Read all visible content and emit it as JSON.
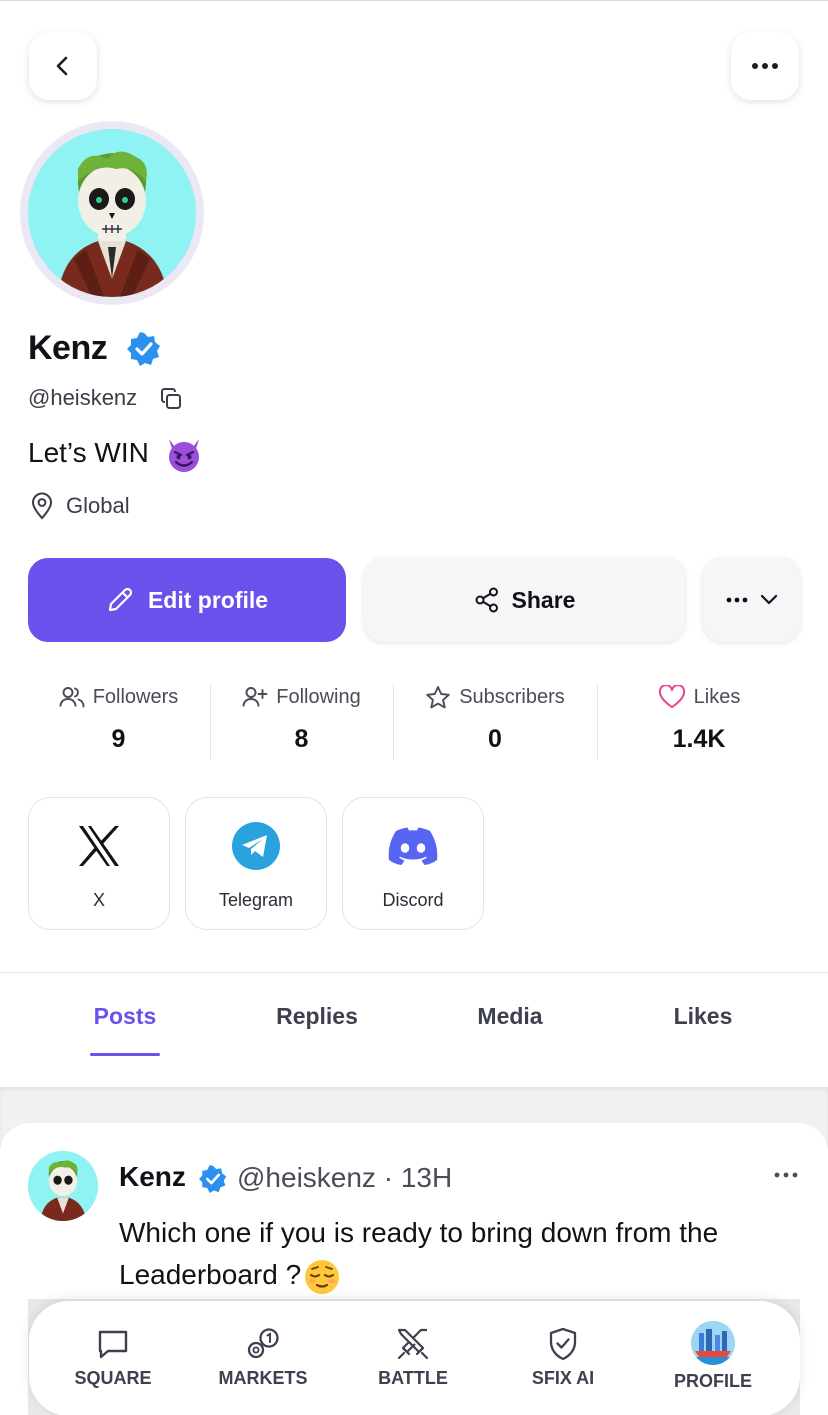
{
  "profile": {
    "name": "Kenz",
    "handle": "@heiskenz",
    "bio": "Let’s WIN",
    "location": "Global"
  },
  "actions": {
    "edit_label": "Edit profile",
    "share_label": "Share"
  },
  "stats": [
    {
      "label": "Followers",
      "value": "9"
    },
    {
      "label": "Following",
      "value": "8"
    },
    {
      "label": "Subscribers",
      "value": "0"
    },
    {
      "label": "Likes",
      "value": "1.4K"
    }
  ],
  "socials": [
    {
      "label": "X",
      "icon": "x-logo-icon"
    },
    {
      "label": "Telegram",
      "icon": "telegram-icon"
    },
    {
      "label": "Discord",
      "icon": "discord-icon"
    }
  ],
  "tabs": [
    {
      "label": "Posts",
      "active": true
    },
    {
      "label": "Replies",
      "active": false
    },
    {
      "label": "Media",
      "active": false
    },
    {
      "label": "Likes",
      "active": false
    }
  ],
  "post": {
    "author": "Kenz",
    "meta": "@heiskenz · 13H",
    "text": "Which one if you is ready to bring down from the Leaderboard ?"
  },
  "nav": [
    {
      "label": "SQUARE",
      "icon": "chat-square-icon"
    },
    {
      "label": "MARKETS",
      "icon": "markets-coins-icon"
    },
    {
      "label": "BATTLE",
      "icon": "crossed-swords-icon"
    },
    {
      "label": "SFIX AI",
      "icon": "shield-check-icon"
    },
    {
      "label": "PROFILE",
      "icon": "profile-avatar-icon"
    }
  ],
  "colors": {
    "accent": "#6b50ec",
    "verified": "#2b90ee",
    "likes_heart": "#e8489a",
    "telegram": "#2aa2dd",
    "discord": "#5865f2"
  }
}
